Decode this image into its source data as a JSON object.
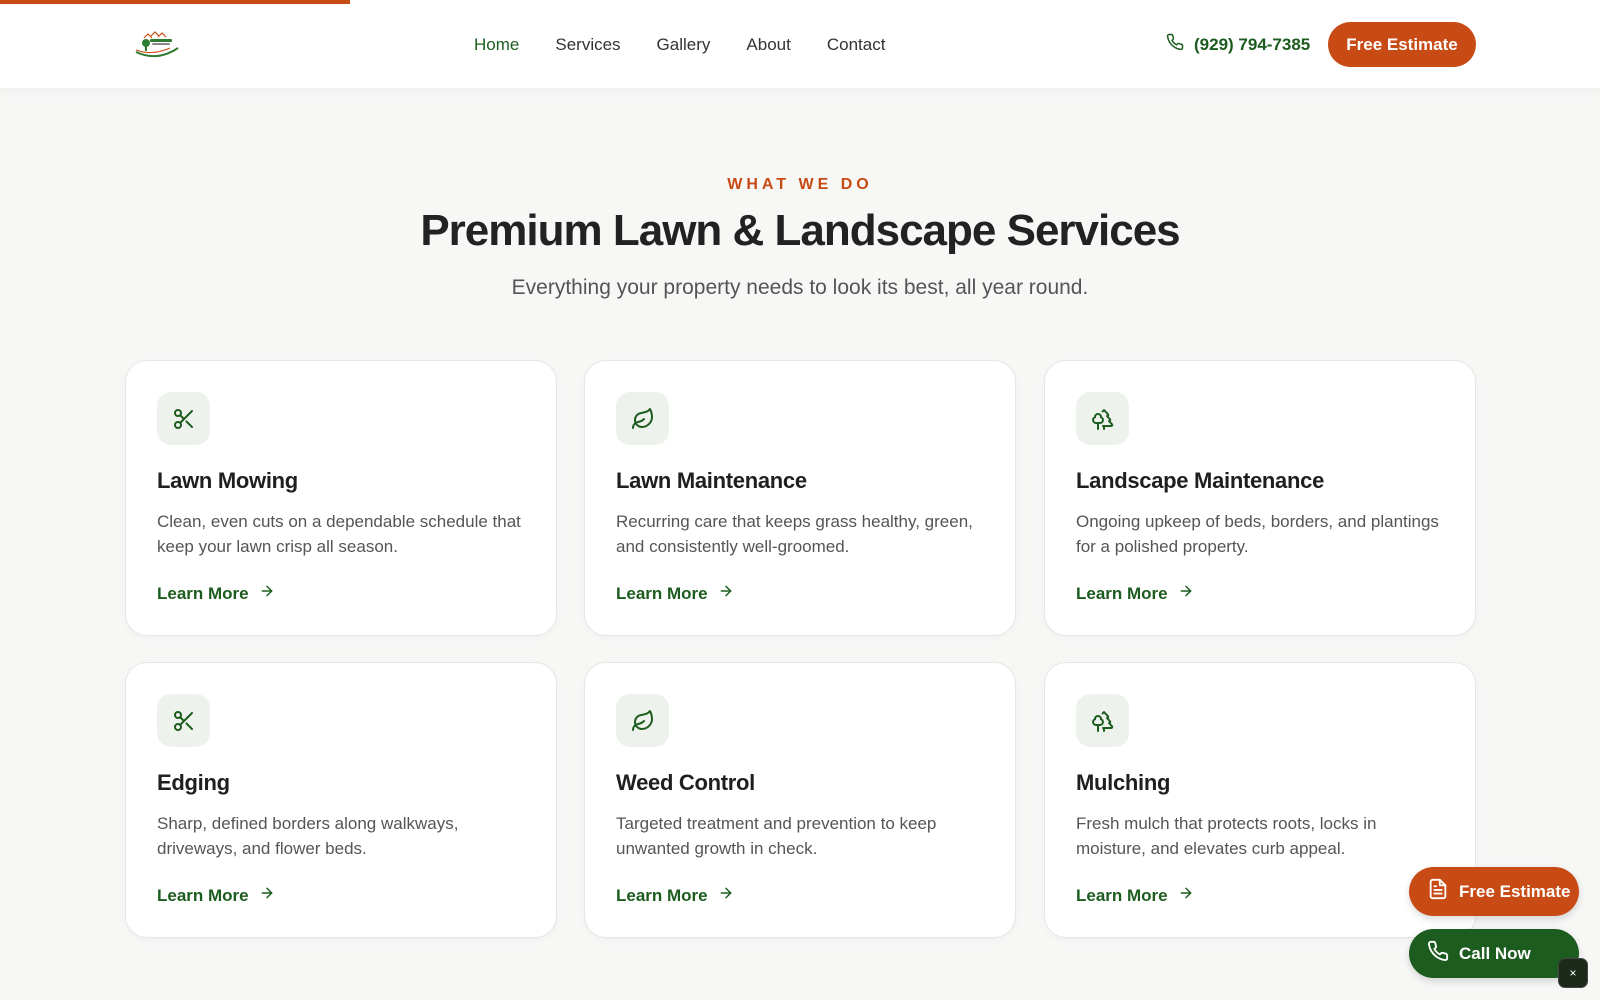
{
  "header": {
    "nav": [
      {
        "label": "Home",
        "active": true
      },
      {
        "label": "Services"
      },
      {
        "label": "Gallery"
      },
      {
        "label": "About"
      },
      {
        "label": "Contact"
      }
    ],
    "phone": "(929) 794-7385",
    "cta": "Free Estimate"
  },
  "section": {
    "eyebrow": "WHAT WE DO",
    "title": "Premium Lawn & Landscape Services",
    "subtitle": "Everything your property needs to look its best, all year round."
  },
  "cards": [
    {
      "icon": "scissors-icon",
      "title": "Lawn Mowing",
      "desc": "Clean, even cuts on a dependable schedule that keep your lawn crisp all season.",
      "link": "Learn More"
    },
    {
      "icon": "leaf-icon",
      "title": "Lawn Maintenance",
      "desc": "Recurring care that keeps grass healthy, green, and consistently well-groomed.",
      "link": "Learn More"
    },
    {
      "icon": "trees-icon",
      "title": "Landscape Maintenance",
      "desc": "Ongoing upkeep of beds, borders, and plantings for a polished property.",
      "link": "Learn More"
    },
    {
      "icon": "scissors-icon",
      "title": "Edging",
      "desc": "Sharp, defined borders along walkways, driveways, and flower beds.",
      "link": "Learn More"
    },
    {
      "icon": "leaf-icon",
      "title": "Weed Control",
      "desc": "Targeted treatment and prevention to keep unwanted growth in check.",
      "link": "Learn More"
    },
    {
      "icon": "trees-icon",
      "title": "Mulching",
      "desc": "Fresh mulch that protects roots, locks in moisture, and elevates curb appeal.",
      "link": "Learn More"
    }
  ],
  "floating": {
    "estimate": "Free Estimate",
    "call": "Call Now",
    "close": "×"
  },
  "colors": {
    "accent": "#c84b15",
    "brand_green": "#1d5c1f",
    "background": "#f7f7f6"
  }
}
